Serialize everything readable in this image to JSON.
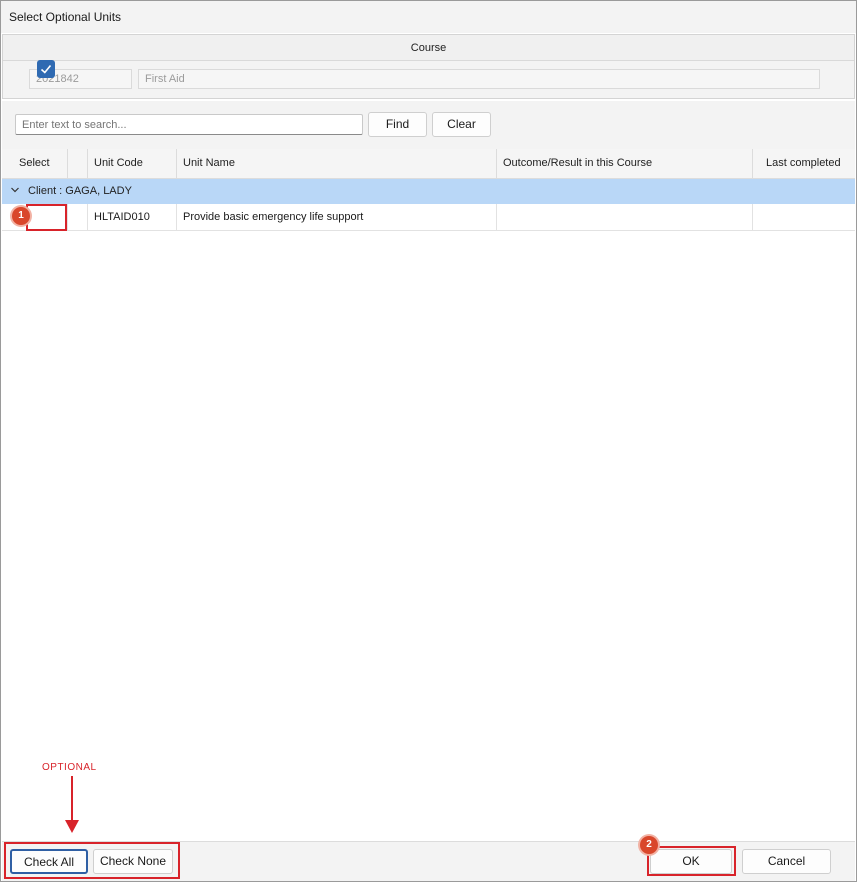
{
  "window": {
    "title": "Select Optional Units"
  },
  "course": {
    "header": "Course",
    "code": "2021842",
    "name": "First Aid"
  },
  "search": {
    "placeholder": "Enter text to search...",
    "find_label": "Find",
    "clear_label": "Clear"
  },
  "grid": {
    "columns": [
      "Select",
      "Unit Code",
      "Unit Name",
      "Outcome/Result in this Course",
      "Last completed"
    ],
    "group_label": "Client : GAGA, LADY",
    "rows": [
      {
        "selected": true,
        "unit_code": "HLTAID010",
        "unit_name": "Provide basic emergency life support",
        "outcome": "",
        "last_completed": ""
      }
    ]
  },
  "annotations": {
    "marker_1": "1",
    "marker_2": "2",
    "optional_label": "OPTIONAL",
    "accent_color": "#d8232a"
  },
  "footer": {
    "check_all_label": "Check All",
    "check_none_label": "Check None",
    "ok_label": "OK",
    "cancel_label": "Cancel"
  },
  "icons": {
    "chevron": "chevron-down-icon",
    "check": "check-icon"
  }
}
